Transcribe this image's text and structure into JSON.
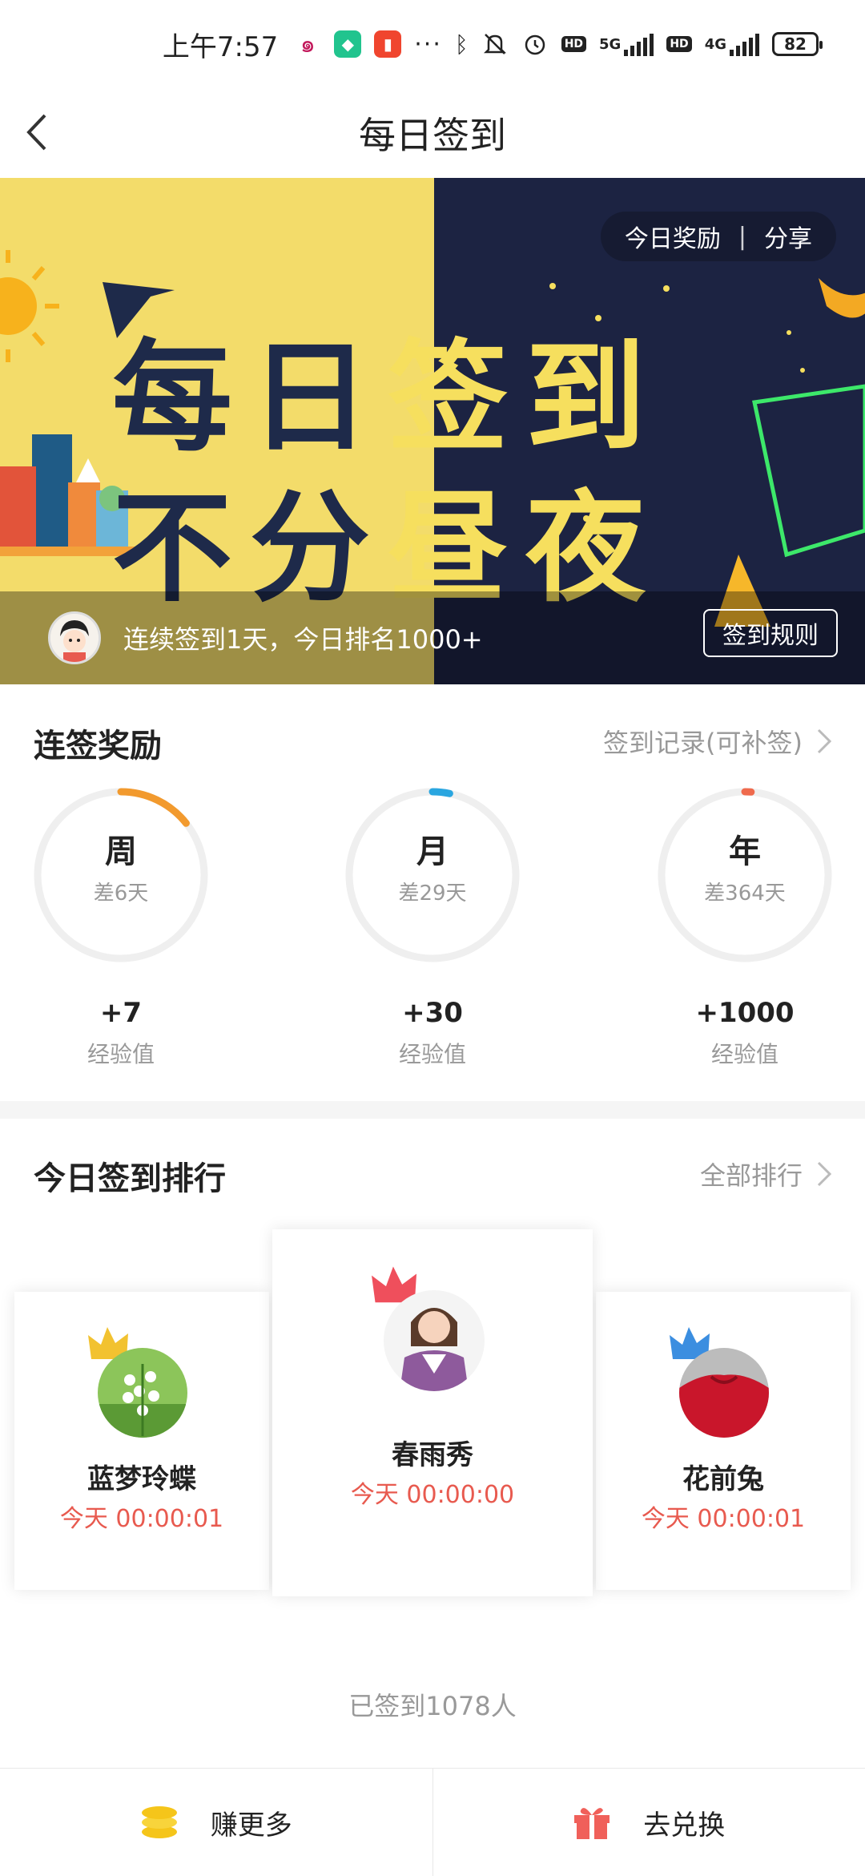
{
  "status_bar": {
    "time": "上午7:57",
    "net1": "5G",
    "net2": "4G",
    "hd": "HD",
    "battery": "82",
    "icons": [
      "weibo-icon",
      "app-green-icon",
      "app-red-icon",
      "more-dots-icon",
      "bluetooth-icon",
      "silent-icon",
      "alarm-icon",
      "signal-icon",
      "battery-icon"
    ]
  },
  "nav": {
    "title": "每日签到"
  },
  "banner": {
    "line1_a": "每日",
    "line1_b": "签到",
    "line2_a": "不分",
    "line2_b": "昼夜",
    "today_reward": "今日奖励",
    "share": "分享",
    "streak_text": "连续签到1天，今日排名1000+",
    "rules_button": "签到规则"
  },
  "streak": {
    "title": "连签奖励",
    "record_link": "签到记录(可补签)",
    "rings": [
      {
        "label": "周",
        "sub": "差6天",
        "points": "+7",
        "unit": "经验值",
        "progress": 0.143,
        "color": "#f29a2e"
      },
      {
        "label": "月",
        "sub": "差29天",
        "points": "+30",
        "unit": "经验值",
        "progress": 0.033,
        "color": "#2aa6e0"
      },
      {
        "label": "年",
        "sub": "差364天",
        "points": "+1000",
        "unit": "经验值",
        "progress": 0.003,
        "color": "#ef6a4d"
      }
    ]
  },
  "ranking": {
    "title": "今日签到排行",
    "all_link": "全部排行",
    "entries": [
      {
        "rank": 2,
        "name": "蓝梦玲蝶",
        "time": "今天 00:00:01",
        "crown_color": "#f2c230"
      },
      {
        "rank": 1,
        "name": "春雨秀",
        "time": "今天 00:00:00",
        "crown_color": "#ef4f5c"
      },
      {
        "rank": 3,
        "name": "花前兔",
        "time": "今天 00:00:01",
        "crown_color": "#3b8ee0"
      }
    ],
    "signed_count": "已签到1078人"
  },
  "bottom": {
    "earn_more": "赚更多",
    "redeem": "去兑换"
  }
}
